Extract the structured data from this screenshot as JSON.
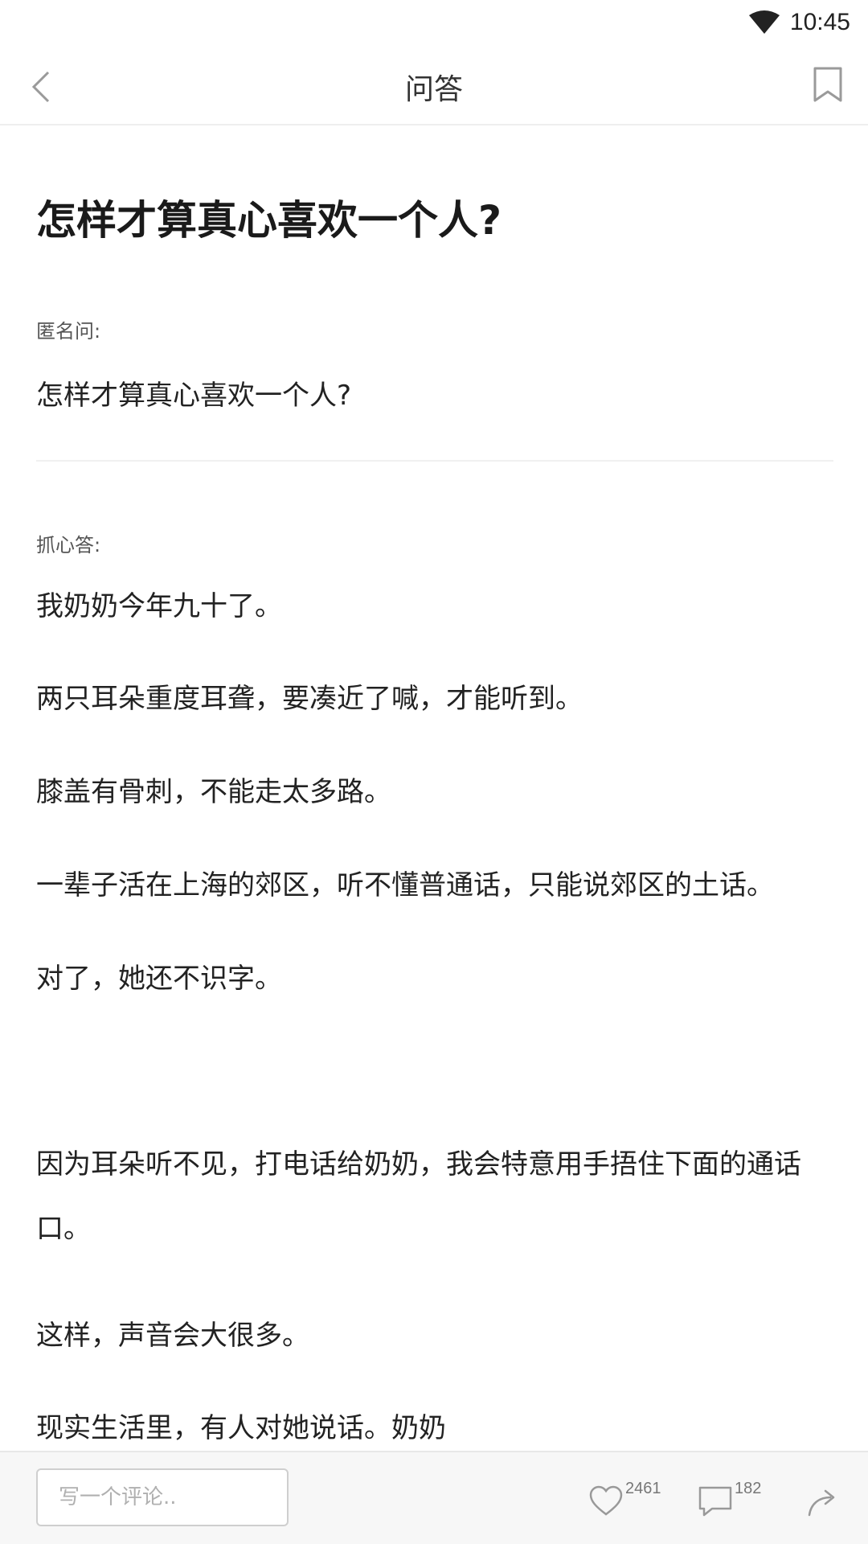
{
  "status_bar": {
    "time": "10:45"
  },
  "header": {
    "title": "问答"
  },
  "question": {
    "title": "怎样才算真心喜欢一个人?",
    "asker_label": "匿名问:",
    "body": "怎样才算真心喜欢一个人?"
  },
  "answer": {
    "answerer_label": "抓心答:",
    "paragraphs": [
      "我奶奶今年九十了。",
      "两只耳朵重度耳聋，要凑近了喊，才能听到。",
      "膝盖有骨刺，不能走太多路。",
      "一辈子活在上海的郊区，听不懂普通话，只能说郊区的土话。",
      "对了，她还不识字。",
      "因为耳朵听不见，打电话给奶奶，我会特意用手捂住下面的通话口。",
      "这样，声音会大很多。",
      "现实生活里，有人对她说话。奶奶"
    ]
  },
  "bottom_bar": {
    "comment_placeholder": "写一个评论..",
    "like_count": "2461",
    "comment_count": "182"
  },
  "icons": {
    "wifi": "wifi-icon",
    "back": "back-chevron-icon",
    "bookmark": "bookmark-icon",
    "like": "heart-icon",
    "comment": "comment-bubble-icon",
    "share": "share-arrow-icon"
  }
}
